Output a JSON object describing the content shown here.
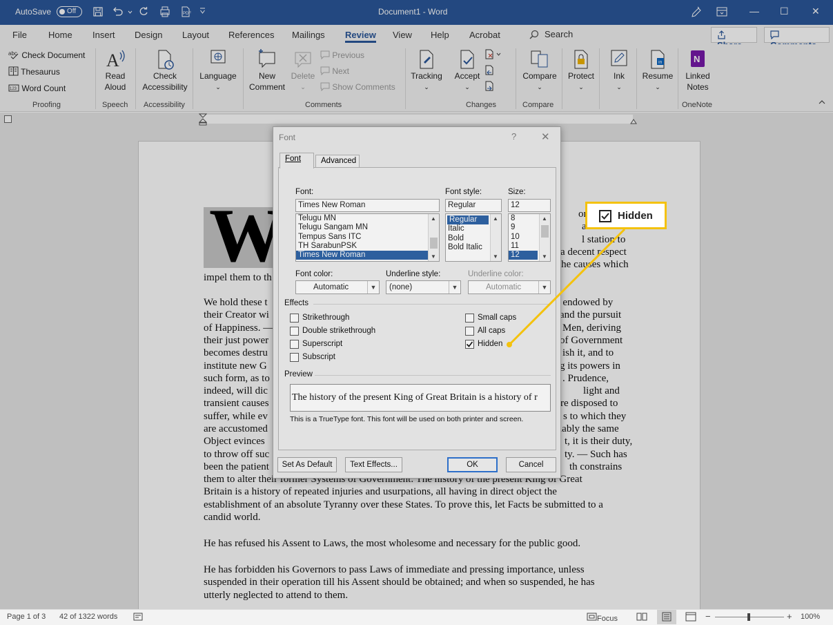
{
  "titlebar": {
    "autosave_label": "AutoSave",
    "autosave_state": "Off",
    "title": "Document1  -  Word",
    "minimize": "—",
    "restore": "☐",
    "close": "✕"
  },
  "tabs": [
    "File",
    "Home",
    "Insert",
    "Design",
    "Layout",
    "References",
    "Mailings",
    "Review",
    "View",
    "Help",
    "Acrobat"
  ],
  "active_tab": "Review",
  "search_label": "Search",
  "share_label": "Share",
  "comments_label": "Comments",
  "ribbon": {
    "proofing": {
      "check_document": "Check Document",
      "thesaurus": "Thesaurus",
      "word_count": "Word Count",
      "group": "Proofing"
    },
    "speech": {
      "read_aloud_1": "Read",
      "read_aloud_2": "Aloud",
      "group": "Speech"
    },
    "accessibility": {
      "check_1": "Check",
      "check_2": "Accessibility",
      "group": "Accessibility"
    },
    "language": {
      "label": "Language"
    },
    "comments": {
      "new_1": "New",
      "new_2": "Comment",
      "delete": "Delete",
      "previous": "Previous",
      "next": "Next",
      "show": "Show Comments",
      "group": "Comments"
    },
    "tracking": {
      "label": "Tracking"
    },
    "changes": {
      "accept": "Accept",
      "group": "Changes"
    },
    "compare": {
      "label": "Compare",
      "group": "Compare"
    },
    "protect": {
      "label": "Protect"
    },
    "ink": {
      "label": "Ink"
    },
    "resume": {
      "label": "Resume"
    },
    "onenote": {
      "linked_1": "Linked",
      "linked_2": "Notes",
      "group": "OneNote"
    }
  },
  "document": {
    "dropcap": "W",
    "lines_right": [
      "one pe",
      "anoth",
      "l station to",
      "a decent respect",
      "the causes which"
    ],
    "line_impel": "impel them to th",
    "para2_left": [
      "We hold these t",
      "their Creator wi",
      "of Happiness. —",
      "their just power",
      "becomes destru",
      "institute new G",
      "such form, as to",
      "indeed, will dic",
      "transient causes",
      "suffer, while ev",
      "are accustomed",
      "Object evinces",
      "to throw off suc",
      "been the patient"
    ],
    "para2_right": [
      "re endowed by",
      "and the pursuit",
      "Men, deriving",
      "of Government",
      "ish it, and to",
      "g its powers in",
      ". Prudence,",
      "light and",
      "re disposed to",
      "s to which they",
      "iably the same",
      "t, it is their duty,",
      "ty. — Such has",
      "th constrains"
    ],
    "para2_full": [
      "them to alter their former Systems of Government. The history of the present King of Great",
      "Britain is a history of repeated injuries and usurpations, all having in direct object the",
      "establishment of an absolute Tyranny over these States. To prove this, let Facts be submitted to a",
      "candid world."
    ],
    "para3": "He has refused his Assent to Laws, the most wholesome and necessary for the public good.",
    "para4": [
      "He has forbidden his Governors to pass Laws of immediate and pressing importance, unless",
      "suspended in their operation till his Assent should be obtained; and when so suspended, he has",
      "utterly neglected to attend to them."
    ]
  },
  "dialog": {
    "title": "Font",
    "help": "?",
    "close": "✕",
    "tabs": [
      "Font",
      "Advanced"
    ],
    "font_label": "Font:",
    "font_value": "Times New Roman",
    "font_list": [
      "Telugu MN",
      "Telugu Sangam MN",
      "Tempus Sans ITC",
      "TH SarabunPSK",
      "Times New Roman"
    ],
    "style_label": "Font style:",
    "style_value": "Regular",
    "style_list": [
      "Regular",
      "Italic",
      "Bold",
      "Bold Italic"
    ],
    "size_label": "Size:",
    "size_value": "12",
    "size_list": [
      "8",
      "9",
      "10",
      "11",
      "12"
    ],
    "font_color_label": "Font color:",
    "font_color_value": "Automatic",
    "underline_style_label": "Underline style:",
    "underline_style_value": "(none)",
    "underline_color_label": "Underline color:",
    "underline_color_value": "Automatic",
    "effects_label": "Effects",
    "effects_left": [
      "Strikethrough",
      "Double strikethrough",
      "Superscript",
      "Subscript"
    ],
    "effects_right": [
      "Small caps",
      "All caps",
      "Hidden"
    ],
    "hidden_checked": true,
    "preview_label": "Preview",
    "preview_text": "The history of the present King of Great Britain is a history of r",
    "truetype_note": "This is a TrueType font. This font will be used on both printer and screen.",
    "set_default": "Set As Default",
    "text_effects": "Text Effects...",
    "ok": "OK",
    "cancel": "Cancel"
  },
  "callout": {
    "label": "Hidden"
  },
  "status": {
    "page": "Page 1 of 3",
    "words": "42 of 1322 words",
    "focus": "Focus",
    "zoom": "100%"
  },
  "colors": {
    "accent": "#2b579a",
    "callout": "#f4c20d",
    "selection": "#2d5f9e"
  }
}
